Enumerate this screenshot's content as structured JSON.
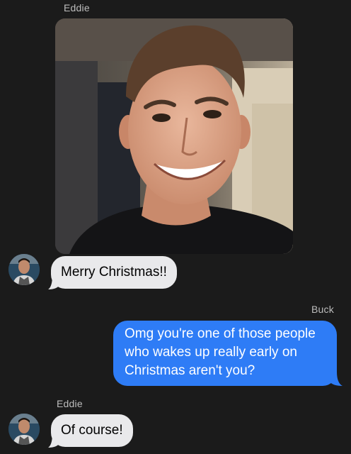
{
  "messages": [
    {
      "sender": "Eddie",
      "text": "Merry Christmas!!"
    },
    {
      "sender": "Buck",
      "text": "Omg you're one of those people who wakes up really early on Christmas aren't you?"
    },
    {
      "sender": "Eddie",
      "text": "Of course!"
    }
  ],
  "photo": {
    "subject": "selfie of smiling man"
  },
  "colors": {
    "background": "#1b1b1b",
    "incoming_bubble": "#e9e9eb",
    "outgoing_bubble": "#2e7cf6",
    "sender_label": "#bdbdbd"
  }
}
